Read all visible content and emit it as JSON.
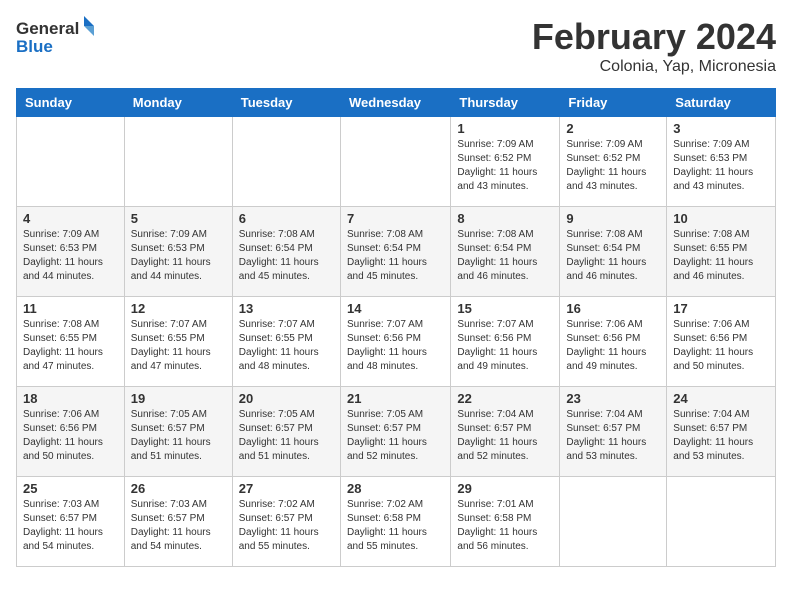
{
  "logo": {
    "general": "General",
    "blue": "Blue"
  },
  "title": "February 2024",
  "subtitle": "Colonia, Yap, Micronesia",
  "days_header": [
    "Sunday",
    "Monday",
    "Tuesday",
    "Wednesday",
    "Thursday",
    "Friday",
    "Saturday"
  ],
  "weeks": [
    [
      {
        "day": "",
        "info": ""
      },
      {
        "day": "",
        "info": ""
      },
      {
        "day": "",
        "info": ""
      },
      {
        "day": "",
        "info": ""
      },
      {
        "day": "1",
        "info": "Sunrise: 7:09 AM\nSunset: 6:52 PM\nDaylight: 11 hours and 43 minutes."
      },
      {
        "day": "2",
        "info": "Sunrise: 7:09 AM\nSunset: 6:52 PM\nDaylight: 11 hours and 43 minutes."
      },
      {
        "day": "3",
        "info": "Sunrise: 7:09 AM\nSunset: 6:53 PM\nDaylight: 11 hours and 43 minutes."
      }
    ],
    [
      {
        "day": "4",
        "info": "Sunrise: 7:09 AM\nSunset: 6:53 PM\nDaylight: 11 hours and 44 minutes."
      },
      {
        "day": "5",
        "info": "Sunrise: 7:09 AM\nSunset: 6:53 PM\nDaylight: 11 hours and 44 minutes."
      },
      {
        "day": "6",
        "info": "Sunrise: 7:08 AM\nSunset: 6:54 PM\nDaylight: 11 hours and 45 minutes."
      },
      {
        "day": "7",
        "info": "Sunrise: 7:08 AM\nSunset: 6:54 PM\nDaylight: 11 hours and 45 minutes."
      },
      {
        "day": "8",
        "info": "Sunrise: 7:08 AM\nSunset: 6:54 PM\nDaylight: 11 hours and 46 minutes."
      },
      {
        "day": "9",
        "info": "Sunrise: 7:08 AM\nSunset: 6:54 PM\nDaylight: 11 hours and 46 minutes."
      },
      {
        "day": "10",
        "info": "Sunrise: 7:08 AM\nSunset: 6:55 PM\nDaylight: 11 hours and 46 minutes."
      }
    ],
    [
      {
        "day": "11",
        "info": "Sunrise: 7:08 AM\nSunset: 6:55 PM\nDaylight: 11 hours and 47 minutes."
      },
      {
        "day": "12",
        "info": "Sunrise: 7:07 AM\nSunset: 6:55 PM\nDaylight: 11 hours and 47 minutes."
      },
      {
        "day": "13",
        "info": "Sunrise: 7:07 AM\nSunset: 6:55 PM\nDaylight: 11 hours and 48 minutes."
      },
      {
        "day": "14",
        "info": "Sunrise: 7:07 AM\nSunset: 6:56 PM\nDaylight: 11 hours and 48 minutes."
      },
      {
        "day": "15",
        "info": "Sunrise: 7:07 AM\nSunset: 6:56 PM\nDaylight: 11 hours and 49 minutes."
      },
      {
        "day": "16",
        "info": "Sunrise: 7:06 AM\nSunset: 6:56 PM\nDaylight: 11 hours and 49 minutes."
      },
      {
        "day": "17",
        "info": "Sunrise: 7:06 AM\nSunset: 6:56 PM\nDaylight: 11 hours and 50 minutes."
      }
    ],
    [
      {
        "day": "18",
        "info": "Sunrise: 7:06 AM\nSunset: 6:56 PM\nDaylight: 11 hours and 50 minutes."
      },
      {
        "day": "19",
        "info": "Sunrise: 7:05 AM\nSunset: 6:57 PM\nDaylight: 11 hours and 51 minutes."
      },
      {
        "day": "20",
        "info": "Sunrise: 7:05 AM\nSunset: 6:57 PM\nDaylight: 11 hours and 51 minutes."
      },
      {
        "day": "21",
        "info": "Sunrise: 7:05 AM\nSunset: 6:57 PM\nDaylight: 11 hours and 52 minutes."
      },
      {
        "day": "22",
        "info": "Sunrise: 7:04 AM\nSunset: 6:57 PM\nDaylight: 11 hours and 52 minutes."
      },
      {
        "day": "23",
        "info": "Sunrise: 7:04 AM\nSunset: 6:57 PM\nDaylight: 11 hours and 53 minutes."
      },
      {
        "day": "24",
        "info": "Sunrise: 7:04 AM\nSunset: 6:57 PM\nDaylight: 11 hours and 53 minutes."
      }
    ],
    [
      {
        "day": "25",
        "info": "Sunrise: 7:03 AM\nSunset: 6:57 PM\nDaylight: 11 hours and 54 minutes."
      },
      {
        "day": "26",
        "info": "Sunrise: 7:03 AM\nSunset: 6:57 PM\nDaylight: 11 hours and 54 minutes."
      },
      {
        "day": "27",
        "info": "Sunrise: 7:02 AM\nSunset: 6:57 PM\nDaylight: 11 hours and 55 minutes."
      },
      {
        "day": "28",
        "info": "Sunrise: 7:02 AM\nSunset: 6:58 PM\nDaylight: 11 hours and 55 minutes."
      },
      {
        "day": "29",
        "info": "Sunrise: 7:01 AM\nSunset: 6:58 PM\nDaylight: 11 hours and 56 minutes."
      },
      {
        "day": "",
        "info": ""
      },
      {
        "day": "",
        "info": ""
      }
    ]
  ]
}
